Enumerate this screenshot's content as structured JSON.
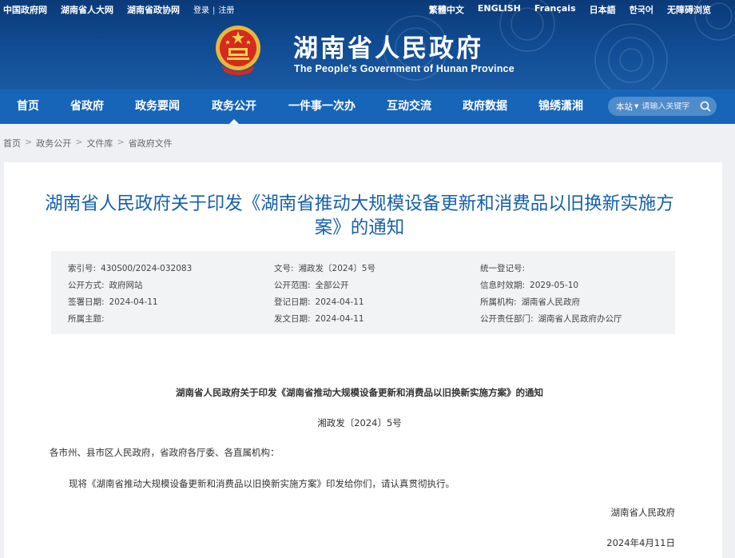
{
  "header": {
    "top_links": [
      "中国政府网",
      "湖南省人大网",
      "湖南省政协网"
    ],
    "login_label": "登录",
    "register_label": "注册",
    "languages": [
      "繁體中文",
      "ENGLISH",
      "Français",
      "日本語",
      "한국어",
      "无障碍浏览"
    ],
    "site_title": "湖南省人民政府",
    "site_subtitle": "The People’s Government of Hunan Province"
  },
  "nav": {
    "items": [
      "首页",
      "省政府",
      "政务要闻",
      "政务公开",
      "一件事一次办",
      "互动交流",
      "政府数据",
      "锦绣潇湘"
    ],
    "active_index": 3
  },
  "search": {
    "scope": "本站",
    "placeholder": "请输入关键字"
  },
  "breadcrumb": [
    "首页",
    "政务公开",
    "文件库",
    "省政府文件"
  ],
  "article": {
    "title": "湖南省人民政府关于印发《湖南省推动大规模设备更新和消费品以旧换新实施方案》的通知",
    "meta": [
      {
        "label": "索引号:",
        "value": "430S00/2024-032083"
      },
      {
        "label": "文号:",
        "value": "湘政发〔2024〕5号"
      },
      {
        "label": "统一登记号:",
        "value": ""
      },
      {
        "label": "公开方式:",
        "value": "政府网站"
      },
      {
        "label": "公开范围:",
        "value": "全部公开"
      },
      {
        "label": "信息时效期:",
        "value": "2029-05-10"
      },
      {
        "label": "签署日期:",
        "value": "2024-04-11"
      },
      {
        "label": "登记日期:",
        "value": "2024-04-11"
      },
      {
        "label": "所属机构:",
        "value": "湖南省人民政府"
      },
      {
        "label": "所属主题:",
        "value": ""
      },
      {
        "label": "发文日期:",
        "value": "2024-04-11"
      },
      {
        "label": "公开责任部门:",
        "value": "湖南省人民政府办公厅"
      }
    ],
    "doc_heading": "湖南省人民政府关于印发《湖南省推动大规模设备更新和消费品以旧换新实施方案》的通知",
    "doc_number": "湘政发〔2024〕5号",
    "addressee": "各市州、县市区人民政府，省政府各厅委、各直属机构：",
    "body": "现将《湖南省推动大规模设备更新和消费品以旧换新实施方案》印发给你们，请认真贯彻执行。",
    "signer": "湖南省人民政府",
    "sign_date": "2024年4月11日"
  }
}
